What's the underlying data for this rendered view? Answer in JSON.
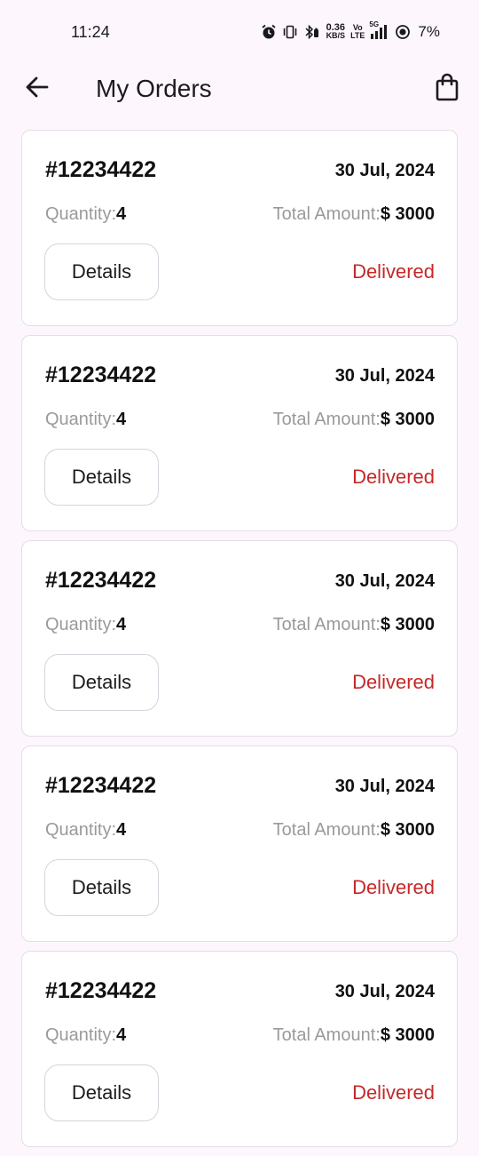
{
  "status_bar": {
    "time": "11:24",
    "net_speed_value": "0.36",
    "net_speed_unit": "KB/S",
    "volte_top": "Vo",
    "volte_bottom": "LTE",
    "network": "5G",
    "battery": "7%",
    "icons": [
      "alarm-icon",
      "vibrate-icon",
      "bluetooth-icon",
      "signal-icon",
      "battery-icon"
    ]
  },
  "app_bar": {
    "title": "My Orders",
    "back_icon": "arrow-left-icon",
    "bag_icon": "shopping-bag-icon"
  },
  "orders": [
    {
      "id": "#12234422",
      "date": "30 Jul, 2024",
      "quantity_label": "Quantity:",
      "quantity": "4",
      "amount_label": "Total Amount:",
      "amount": "$ 3000",
      "details_label": "Details",
      "status": "Delivered"
    },
    {
      "id": "#12234422",
      "date": "30 Jul, 2024",
      "quantity_label": "Quantity:",
      "quantity": "4",
      "amount_label": "Total Amount:",
      "amount": "$ 3000",
      "details_label": "Details",
      "status": "Delivered"
    },
    {
      "id": "#12234422",
      "date": "30 Jul, 2024",
      "quantity_label": "Quantity:",
      "quantity": "4",
      "amount_label": "Total Amount:",
      "amount": "$ 3000",
      "details_label": "Details",
      "status": "Delivered"
    },
    {
      "id": "#12234422",
      "date": "30 Jul, 2024",
      "quantity_label": "Quantity:",
      "quantity": "4",
      "amount_label": "Total Amount:",
      "amount": "$ 3000",
      "details_label": "Details",
      "status": "Delivered"
    },
    {
      "id": "#12234422",
      "date": "30 Jul, 2024",
      "quantity_label": "Quantity:",
      "quantity": "4",
      "amount_label": "Total Amount:",
      "amount": "$ 3000",
      "details_label": "Details",
      "status": "Delivered"
    }
  ],
  "colors": {
    "background": "#fdf7fd",
    "card": "#ffffff",
    "status_delivered": "#c62828",
    "muted_text": "#9a9a9a"
  }
}
